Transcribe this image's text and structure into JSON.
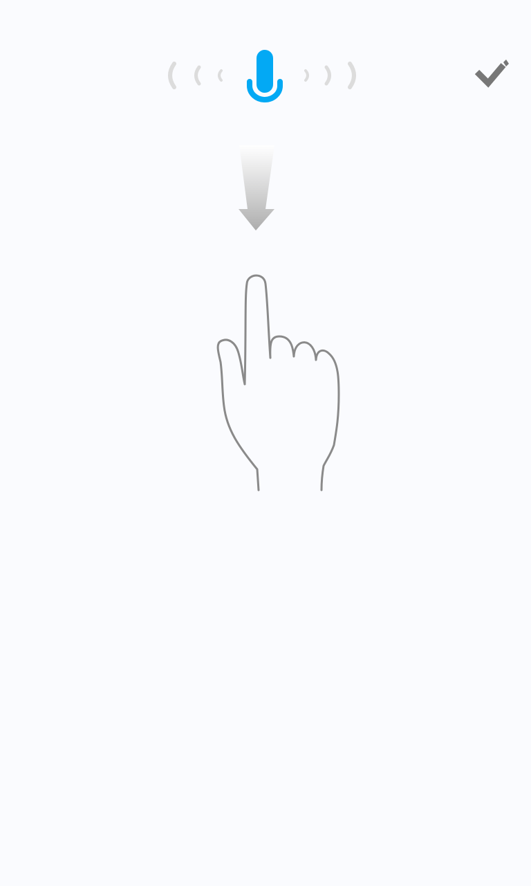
{
  "screen": {
    "background_color": "#FAFBFE"
  },
  "voice_indicator": {
    "icon": "microphone-icon",
    "mic_color": "#03A9F4",
    "wave_color": "#DCDCDC"
  },
  "toolbar": {
    "confirm_icon": "checkmark-icon",
    "icon_color": "#777777"
  },
  "gesture_hint": {
    "direction": "swipe-down",
    "arrow_icon": "down-arrow-icon",
    "hand_icon": "pointing-hand-icon",
    "hand_stroke_color": "#8A8A8A"
  }
}
